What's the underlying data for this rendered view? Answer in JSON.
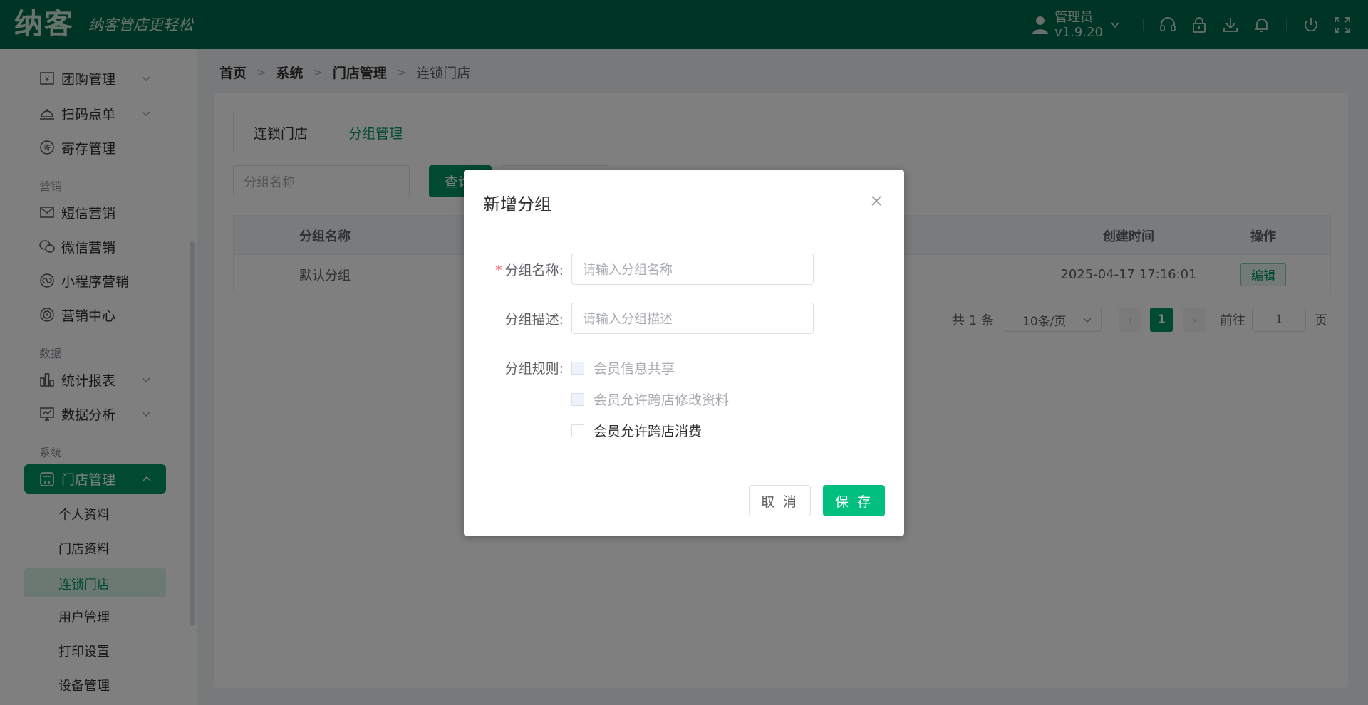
{
  "header": {
    "logo": "纳客",
    "slogan": "纳客管店更轻松",
    "user_name": "管理员",
    "version": "v1.9.20"
  },
  "sidebar": {
    "items": [
      {
        "label": "团购管理",
        "icon": "coupon-icon"
      },
      {
        "label": "扫码点单",
        "icon": "bell-service-icon"
      },
      {
        "label": "寄存管理",
        "icon": "deposit-icon"
      }
    ],
    "group_marketing": "营销",
    "marketing_items": [
      {
        "label": "短信营销",
        "icon": "mail-icon"
      },
      {
        "label": "微信营销",
        "icon": "wechat-icon"
      },
      {
        "label": "小程序营销",
        "icon": "miniprogram-icon"
      },
      {
        "label": "营销中心",
        "icon": "target-icon"
      }
    ],
    "group_data": "数据",
    "data_items": [
      {
        "label": "统计报表",
        "icon": "bar-chart-icon"
      },
      {
        "label": "数据分析",
        "icon": "monitor-chart-icon"
      }
    ],
    "group_system": "系统",
    "active_item": "门店管理",
    "sub_items": [
      "个人资料",
      "门店资料",
      "连锁门店",
      "用户管理",
      "打印设置",
      "设备管理"
    ]
  },
  "breadcrumb": [
    "首页",
    "系统",
    "门店管理",
    "连锁门店"
  ],
  "tabs": [
    "连锁门店",
    "分组管理"
  ],
  "search": {
    "placeholder": "分组名称",
    "button": "查询"
  },
  "table": {
    "headers": {
      "name": "分组名称",
      "created": "创建时间",
      "actions": "操作"
    },
    "rows": [
      {
        "name": "默认分组",
        "created": "2025-04-17 17:16:01",
        "action": "编辑"
      }
    ]
  },
  "pagination": {
    "total": "共 1 条",
    "page_size": "10条/页",
    "current": "1",
    "goto_label": "前往",
    "goto_value": "1",
    "page_suffix": "页"
  },
  "dialog": {
    "title": "新增分组",
    "name_label": "分组名称:",
    "name_placeholder": "请输入分组名称",
    "desc_label": "分组描述:",
    "desc_placeholder": "请输入分组描述",
    "rules_label": "分组规则:",
    "rules": [
      {
        "label": "会员信息共享",
        "disabled": true
      },
      {
        "label": "会员允许跨店修改资料",
        "disabled": true
      },
      {
        "label": "会员允许跨店消费",
        "disabled": false
      }
    ],
    "cancel": "取 消",
    "save": "保 存"
  },
  "colors": {
    "header_bg": "#00694a",
    "accent": "#009463",
    "save_button": "#00bf7f"
  }
}
